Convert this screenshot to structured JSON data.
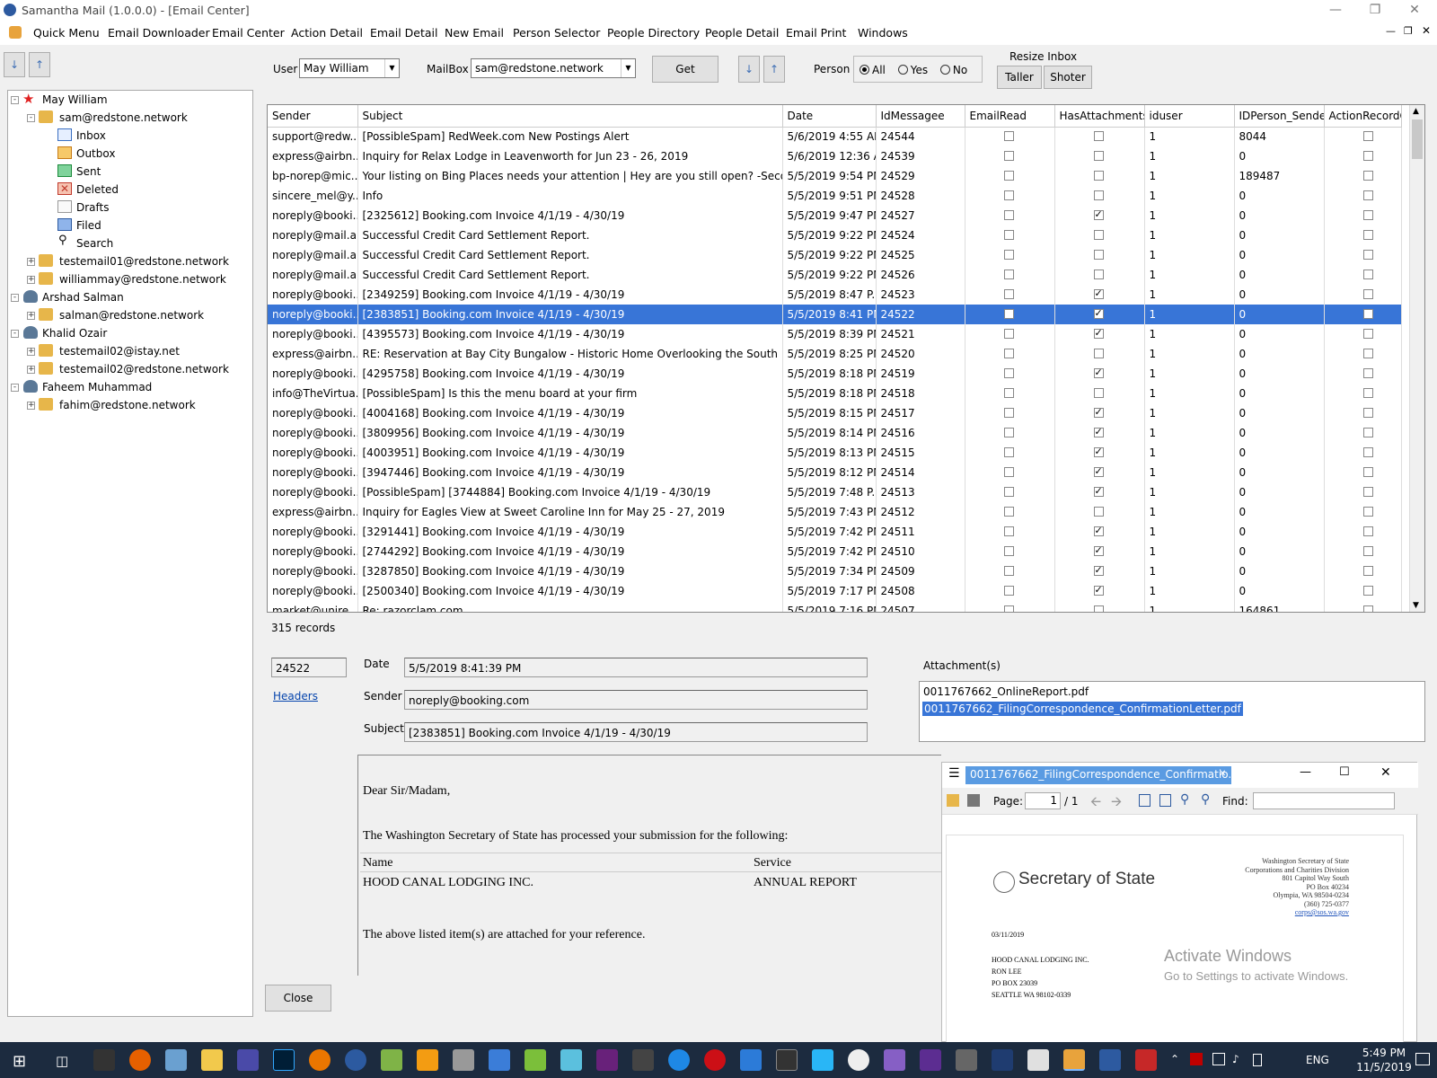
{
  "window": {
    "title": "Samantha Mail (1.0.0.0) - [Email Center]"
  },
  "menu": [
    "Quick Menu",
    "Email Downloader",
    "Email Center",
    "Action Detail",
    "Email Detail",
    "New Email",
    "Person Selector",
    "People Directory",
    "People Detail",
    "Email Print",
    "Windows"
  ],
  "toolbar": {
    "user_label": "User",
    "user_value": "May William",
    "mailbox_label": "MailBox",
    "mailbox_value": "sam@redstone.network",
    "get_label": "Get",
    "person_label": "Person",
    "radio_all": "All",
    "radio_yes": "Yes",
    "radio_no": "No",
    "resize_label": "Resize Inbox",
    "taller_label": "Taller",
    "shorter_label": "Shoter"
  },
  "tree": {
    "user1": "May William",
    "account1": "sam@redstone.network",
    "folders": [
      "Inbox",
      "Outbox",
      "Sent",
      "Deleted",
      "Drafts",
      "Filed",
      "Search"
    ],
    "account2": "testemail01@redstone.network",
    "account3": "williammay@redstone.network",
    "user2": "Arshad Salman",
    "account4": "salman@redstone.network",
    "user3": "Khalid Ozair",
    "account5": "testemail02@istay.net",
    "account6": "testemail02@redstone.network",
    "user4": "Faheem Muhammad",
    "account7": "fahim@redstone.network"
  },
  "grid": {
    "columns": [
      "Sender",
      "Subject",
      "Date",
      "IdMessagee",
      "EmailRead",
      "HasAttachments",
      "iduser",
      "IDPerson_Sender",
      "ActionRecordCrea"
    ],
    "rows": [
      {
        "sender": "support@redw...",
        "subject": "[PossibleSpam] RedWeek.com New Postings Alert",
        "date": "5/6/2019 4:55 AM",
        "id": "24544",
        "read": false,
        "att": false,
        "iduser": "1",
        "person": "8044"
      },
      {
        "sender": "express@airbn...",
        "subject": "Inquiry for Relax Lodge in Leavenworth for Jun 23 - 26, 2019",
        "date": "5/6/2019 12:36 A...",
        "id": "24539",
        "read": false,
        "att": false,
        "iduser": "1",
        "person": "0"
      },
      {
        "sender": "bp-norep@mic...",
        "subject": "Your listing on Bing Places needs your attention | Hey are you still open? -Second R...",
        "date": "5/5/2019 9:54 PM",
        "id": "24529",
        "read": false,
        "att": false,
        "iduser": "1",
        "person": "189487"
      },
      {
        "sender": "sincere_mel@y...",
        "subject": "Info",
        "date": "5/5/2019 9:51 PM",
        "id": "24528",
        "read": false,
        "att": false,
        "iduser": "1",
        "person": "0"
      },
      {
        "sender": "noreply@booki...",
        "subject": "[2325612] Booking.com Invoice 4/1/19 - 4/30/19",
        "date": "5/5/2019 9:47 PM",
        "id": "24527",
        "read": false,
        "att": true,
        "iduser": "1",
        "person": "0"
      },
      {
        "sender": "noreply@mail.a...",
        "subject": "Successful Credit Card Settlement Report.",
        "date": "5/5/2019 9:22 PM",
        "id": "24524",
        "read": false,
        "att": false,
        "iduser": "1",
        "person": "0"
      },
      {
        "sender": "noreply@mail.a...",
        "subject": "Successful Credit Card Settlement Report.",
        "date": "5/5/2019 9:22 PM",
        "id": "24525",
        "read": false,
        "att": false,
        "iduser": "1",
        "person": "0"
      },
      {
        "sender": "noreply@mail.a...",
        "subject": "Successful Credit Card Settlement Report.",
        "date": "5/5/2019 9:22 PM",
        "id": "24526",
        "read": false,
        "att": false,
        "iduser": "1",
        "person": "0"
      },
      {
        "sender": "noreply@booki...",
        "subject": "[2349259] Booking.com Invoice 4/1/19 - 4/30/19",
        "date": "5/5/2019 8:47 P...",
        "id": "24523",
        "read": false,
        "att": true,
        "iduser": "1",
        "person": "0"
      },
      {
        "sender": "noreply@booki...",
        "subject": "[2383851] Booking.com Invoice 4/1/19 - 4/30/19",
        "date": "5/5/2019 8:41 PM",
        "id": "24522",
        "read": false,
        "att": true,
        "iduser": "1",
        "person": "0",
        "selected": true
      },
      {
        "sender": "noreply@booki...",
        "subject": "[4395573] Booking.com Invoice 4/1/19 - 4/30/19",
        "date": "5/5/2019 8:39 PM",
        "id": "24521",
        "read": false,
        "att": true,
        "iduser": "1",
        "person": "0"
      },
      {
        "sender": "express@airbn...",
        "subject": "RE: Reservation at Bay City Bungalow - Historic Home Overlooking the South Bay for ...",
        "date": "5/5/2019 8:25 PM",
        "id": "24520",
        "read": false,
        "att": false,
        "iduser": "1",
        "person": "0"
      },
      {
        "sender": "noreply@booki...",
        "subject": "[4295758] Booking.com Invoice 4/1/19 - 4/30/19",
        "date": "5/5/2019 8:18 PM",
        "id": "24519",
        "read": false,
        "att": true,
        "iduser": "1",
        "person": "0"
      },
      {
        "sender": "info@TheVirtua...",
        "subject": "[PossibleSpam] Is this the menu board at your firm",
        "date": "5/5/2019 8:18 PM",
        "id": "24518",
        "read": false,
        "att": false,
        "iduser": "1",
        "person": "0"
      },
      {
        "sender": "noreply@booki...",
        "subject": "[4004168] Booking.com Invoice 4/1/19 - 4/30/19",
        "date": "5/5/2019 8:15 PM",
        "id": "24517",
        "read": false,
        "att": true,
        "iduser": "1",
        "person": "0"
      },
      {
        "sender": "noreply@booki...",
        "subject": "[3809956] Booking.com Invoice 4/1/19 - 4/30/19",
        "date": "5/5/2019 8:14 PM",
        "id": "24516",
        "read": false,
        "att": true,
        "iduser": "1",
        "person": "0"
      },
      {
        "sender": "noreply@booki...",
        "subject": "[4003951] Booking.com Invoice 4/1/19 - 4/30/19",
        "date": "5/5/2019 8:13 PM",
        "id": "24515",
        "read": false,
        "att": true,
        "iduser": "1",
        "person": "0"
      },
      {
        "sender": "noreply@booki...",
        "subject": "[3947446] Booking.com Invoice 4/1/19 - 4/30/19",
        "date": "5/5/2019 8:12 PM",
        "id": "24514",
        "read": false,
        "att": true,
        "iduser": "1",
        "person": "0"
      },
      {
        "sender": "noreply@booki...",
        "subject": "[PossibleSpam] [3744884] Booking.com Invoice 4/1/19 - 4/30/19",
        "date": "5/5/2019 7:48 P...",
        "id": "24513",
        "read": false,
        "att": true,
        "iduser": "1",
        "person": "0"
      },
      {
        "sender": "express@airbn...",
        "subject": "Inquiry for Eagles View at Sweet Caroline Inn for May 25 - 27, 2019",
        "date": "5/5/2019 7:43 PM",
        "id": "24512",
        "read": false,
        "att": false,
        "iduser": "1",
        "person": "0"
      },
      {
        "sender": "noreply@booki...",
        "subject": "[3291441] Booking.com Invoice 4/1/19 - 4/30/19",
        "date": "5/5/2019 7:42 PM",
        "id": "24511",
        "read": false,
        "att": true,
        "iduser": "1",
        "person": "0"
      },
      {
        "sender": "noreply@booki...",
        "subject": "[2744292] Booking.com Invoice 4/1/19 - 4/30/19",
        "date": "5/5/2019 7:42 PM",
        "id": "24510",
        "read": false,
        "att": true,
        "iduser": "1",
        "person": "0"
      },
      {
        "sender": "noreply@booki...",
        "subject": "[3287850] Booking.com Invoice 4/1/19 - 4/30/19",
        "date": "5/5/2019 7:34 PM",
        "id": "24509",
        "read": false,
        "att": true,
        "iduser": "1",
        "person": "0"
      },
      {
        "sender": "noreply@booki...",
        "subject": "[2500340] Booking.com Invoice 4/1/19 - 4/30/19",
        "date": "5/5/2019 7:17 PM",
        "id": "24508",
        "read": false,
        "att": true,
        "iduser": "1",
        "person": "0"
      },
      {
        "sender": "market@unire...",
        "subject": "Re: razorclam.com",
        "date": "5/5/2019 7:16 PM",
        "id": "24507",
        "read": false,
        "att": false,
        "iduser": "1",
        "person": "164861"
      }
    ]
  },
  "records": "315 records",
  "detail": {
    "id_value": "24522",
    "headers_link": "Headers",
    "date_label": "Date",
    "date_value": "5/5/2019 8:41:39 PM",
    "sender_label": "Sender",
    "sender_value": "noreply@booking.com",
    "subject_label": "Subject",
    "subject_value": "[2383851] Booking.com Invoice 4/1/19 - 4/30/19",
    "attachments_label": "Attachment(s)",
    "attachments": [
      "0011767662_OnlineReport.pdf",
      "0011767662_FilingCorrespondence_ConfirmationLetter.pdf"
    ],
    "close_label": "Close"
  },
  "body": {
    "greeting": "Dear Sir/Madam,",
    "line1": "The Washington Secretary of State has processed your submission for the following:",
    "col_name": "Name",
    "col_service": "Service",
    "name_value": "HOOD CANAL LODGING INC.",
    "service_value": "ANNUAL REPORT",
    "line2": "The above listed item(s) are attached for your reference."
  },
  "pdf": {
    "tab_title": "0011767662_FilingCorrespondence_Confirmatio...",
    "page_label": "Page:",
    "page_value": "1",
    "page_total": "/ 1",
    "find_label": "Find:",
    "seal_title": "Secretary of State",
    "addr": [
      "Washington Secretary of State",
      "Corporations and Charities Division",
      "801 Capitol Way South",
      "PO Box 40234",
      "Olympia, WA 98504-0234",
      "(360) 725-0377",
      "corps@sos.wa.gov"
    ],
    "date": "03/11/2019",
    "recipient": [
      "HOOD CANAL LODGING INC.",
      "RON LEE",
      "PO BOX 23039",
      "SEATTLE WA 98102-0339"
    ],
    "watermark1": "Activate Windows",
    "watermark2": "Go to Settings to activate Windows."
  },
  "taskbar": {
    "lang": "ENG",
    "time": "5:49 PM",
    "date": "11/5/2019"
  },
  "colors": {
    "selection": "#3875d7",
    "taskbar": "#1c2b3f"
  }
}
